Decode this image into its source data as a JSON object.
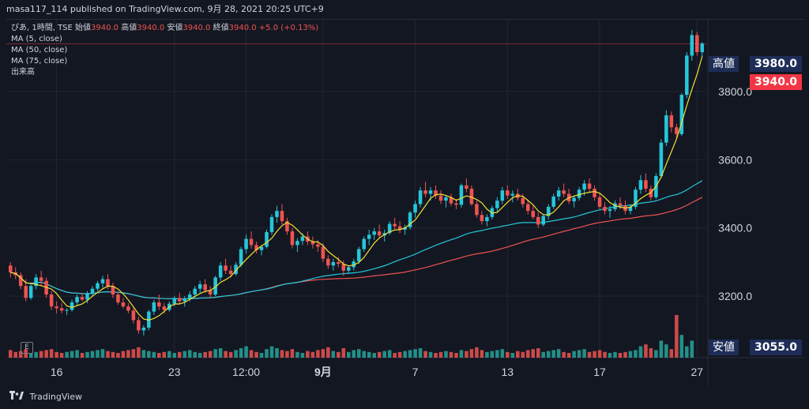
{
  "header": {
    "publisher_text": "masa117_114 published on TradingView.com, 9月 28, 2021 20:25 UTC+9"
  },
  "legend": {
    "symbol_text": "ぴあ, 1時間, TSE",
    "ohlc": [
      {
        "label": "始値",
        "value": "3940.0"
      },
      {
        "label": "高値",
        "value": "3940.0"
      },
      {
        "label": "安値",
        "value": "3940.0"
      },
      {
        "label": "終値",
        "value": "3940.0"
      }
    ],
    "change": "+5.0 (+0.13%)",
    "indicators": [
      "MA (5, close)",
      "MA (50, close)",
      "MA (75, close)",
      "出来高"
    ]
  },
  "price_tags": {
    "high_label": "高値",
    "high_value": "3980.0",
    "last_value": "3940.0",
    "low_label": "安値",
    "low_value": "3055.0"
  },
  "e_badge": "E",
  "footer": {
    "brand": "TradingView"
  },
  "colors": {
    "up": "#26a69a",
    "up_candle": "#26c6da",
    "down": "#ef5350",
    "ma5": "#f2e035",
    "ma50": "#26c6da",
    "ma75": "#ef5350",
    "high_tag_bg": "#1e2d57",
    "last_tag_bg": "#f23645"
  },
  "chart_data": {
    "type": "candlestick",
    "y_axis": {
      "min": 3020,
      "max": 4010,
      "ticks": [
        3200.0,
        3400.0,
        3600.0,
        3800.0
      ]
    },
    "x_ticks": [
      {
        "index": 9,
        "label": "16"
      },
      {
        "index": 32,
        "label": "23"
      },
      {
        "index": 46,
        "label": "12:00"
      },
      {
        "index": 61,
        "label": "9月"
      },
      {
        "index": 79,
        "label": "7"
      },
      {
        "index": 97,
        "label": "13"
      },
      {
        "index": 115,
        "label": "17"
      },
      {
        "index": 134,
        "label": "27"
      }
    ],
    "ohlc": [
      [
        3290,
        3300,
        3255,
        3270
      ],
      [
        3270,
        3285,
        3250,
        3262
      ],
      [
        3262,
        3270,
        3220,
        3230
      ],
      [
        3230,
        3250,
        3185,
        3195
      ],
      [
        3195,
        3240,
        3190,
        3230
      ],
      [
        3230,
        3265,
        3220,
        3255
      ],
      [
        3255,
        3275,
        3230,
        3245
      ],
      [
        3245,
        3255,
        3195,
        3205
      ],
      [
        3205,
        3215,
        3160,
        3170
      ],
      [
        3170,
        3185,
        3150,
        3165
      ],
      [
        3165,
        3180,
        3150,
        3158
      ],
      [
        3158,
        3165,
        3145,
        3160
      ],
      [
        3160,
        3190,
        3155,
        3182
      ],
      [
        3182,
        3205,
        3175,
        3198
      ],
      [
        3198,
        3210,
        3185,
        3190
      ],
      [
        3190,
        3215,
        3180,
        3208
      ],
      [
        3208,
        3230,
        3200,
        3222
      ],
      [
        3222,
        3245,
        3215,
        3238
      ],
      [
        3238,
        3260,
        3225,
        3250
      ],
      [
        3250,
        3265,
        3220,
        3230
      ],
      [
        3230,
        3240,
        3195,
        3205
      ],
      [
        3205,
        3215,
        3175,
        3182
      ],
      [
        3182,
        3195,
        3165,
        3170
      ],
      [
        3170,
        3180,
        3150,
        3158
      ],
      [
        3158,
        3165,
        3120,
        3130
      ],
      [
        3130,
        3140,
        3090,
        3100
      ],
      [
        3100,
        3115,
        3085,
        3108
      ],
      [
        3108,
        3160,
        3100,
        3155
      ],
      [
        3155,
        3190,
        3145,
        3182
      ],
      [
        3182,
        3205,
        3160,
        3170
      ],
      [
        3170,
        3180,
        3150,
        3160
      ],
      [
        3160,
        3185,
        3155,
        3178
      ],
      [
        3178,
        3200,
        3170,
        3195
      ],
      [
        3195,
        3210,
        3175,
        3185
      ],
      [
        3185,
        3200,
        3170,
        3192
      ],
      [
        3192,
        3215,
        3185,
        3205
      ],
      [
        3205,
        3230,
        3195,
        3222
      ],
      [
        3222,
        3245,
        3210,
        3235
      ],
      [
        3235,
        3250,
        3210,
        3218
      ],
      [
        3218,
        3230,
        3195,
        3205
      ],
      [
        3205,
        3260,
        3200,
        3255
      ],
      [
        3255,
        3300,
        3245,
        3290
      ],
      [
        3290,
        3310,
        3265,
        3275
      ],
      [
        3275,
        3290,
        3255,
        3265
      ],
      [
        3265,
        3300,
        3260,
        3292
      ],
      [
        3292,
        3345,
        3285,
        3338
      ],
      [
        3338,
        3380,
        3325,
        3368
      ],
      [
        3368,
        3390,
        3340,
        3350
      ],
      [
        3350,
        3360,
        3325,
        3335
      ],
      [
        3335,
        3350,
        3320,
        3345
      ],
      [
        3345,
        3395,
        3340,
        3388
      ],
      [
        3388,
        3440,
        3380,
        3432
      ],
      [
        3432,
        3465,
        3415,
        3450
      ],
      [
        3450,
        3470,
        3410,
        3420
      ],
      [
        3420,
        3430,
        3380,
        3390
      ],
      [
        3390,
        3400,
        3340,
        3350
      ],
      [
        3350,
        3370,
        3330,
        3362
      ],
      [
        3362,
        3385,
        3350,
        3375
      ],
      [
        3375,
        3390,
        3350,
        3360
      ],
      [
        3360,
        3375,
        3340,
        3352
      ],
      [
        3352,
        3365,
        3330,
        3345
      ],
      [
        3345,
        3355,
        3300,
        3310
      ],
      [
        3310,
        3320,
        3280,
        3290
      ],
      [
        3290,
        3310,
        3275,
        3300
      ],
      [
        3300,
        3315,
        3285,
        3295
      ],
      [
        3295,
        3305,
        3260,
        3275
      ],
      [
        3275,
        3290,
        3265,
        3285
      ],
      [
        3285,
        3310,
        3275,
        3302
      ],
      [
        3302,
        3345,
        3295,
        3338
      ],
      [
        3338,
        3375,
        3330,
        3368
      ],
      [
        3368,
        3395,
        3350,
        3380
      ],
      [
        3380,
        3400,
        3365,
        3390
      ],
      [
        3390,
        3410,
        3370,
        3378
      ],
      [
        3378,
        3395,
        3360,
        3385
      ],
      [
        3385,
        3420,
        3380,
        3412
      ],
      [
        3412,
        3430,
        3395,
        3405
      ],
      [
        3405,
        3420,
        3385,
        3395
      ],
      [
        3395,
        3410,
        3380,
        3402
      ],
      [
        3402,
        3450,
        3395,
        3445
      ],
      [
        3445,
        3480,
        3430,
        3470
      ],
      [
        3470,
        3520,
        3460,
        3510
      ],
      [
        3510,
        3535,
        3490,
        3500
      ],
      [
        3500,
        3520,
        3480,
        3510
      ],
      [
        3510,
        3525,
        3485,
        3495
      ],
      [
        3495,
        3510,
        3470,
        3480
      ],
      [
        3480,
        3495,
        3460,
        3490
      ],
      [
        3490,
        3500,
        3465,
        3472
      ],
      [
        3472,
        3485,
        3455,
        3468
      ],
      [
        3468,
        3530,
        3460,
        3525
      ],
      [
        3525,
        3545,
        3505,
        3515
      ],
      [
        3515,
        3525,
        3465,
        3470
      ],
      [
        3470,
        3480,
        3430,
        3438
      ],
      [
        3438,
        3450,
        3410,
        3420
      ],
      [
        3420,
        3440,
        3405,
        3432
      ],
      [
        3432,
        3465,
        3425,
        3458
      ],
      [
        3458,
        3490,
        3445,
        3480
      ],
      [
        3480,
        3520,
        3470,
        3510
      ],
      [
        3510,
        3525,
        3485,
        3495
      ],
      [
        3495,
        3510,
        3475,
        3500
      ],
      [
        3500,
        3515,
        3480,
        3488
      ],
      [
        3488,
        3500,
        3460,
        3470
      ],
      [
        3470,
        3480,
        3440,
        3450
      ],
      [
        3450,
        3465,
        3425,
        3432
      ],
      [
        3432,
        3445,
        3400,
        3410
      ],
      [
        3410,
        3440,
        3405,
        3435
      ],
      [
        3435,
        3470,
        3425,
        3462
      ],
      [
        3462,
        3500,
        3455,
        3492
      ],
      [
        3492,
        3520,
        3480,
        3510
      ],
      [
        3510,
        3530,
        3490,
        3500
      ],
      [
        3500,
        3515,
        3470,
        3478
      ],
      [
        3478,
        3495,
        3460,
        3488
      ],
      [
        3488,
        3520,
        3480,
        3512
      ],
      [
        3512,
        3540,
        3495,
        3530
      ],
      [
        3530,
        3545,
        3505,
        3515
      ],
      [
        3515,
        3525,
        3480,
        3490
      ],
      [
        3490,
        3500,
        3455,
        3462
      ],
      [
        3462,
        3475,
        3440,
        3450
      ],
      [
        3450,
        3465,
        3430,
        3455
      ],
      [
        3455,
        3480,
        3448,
        3472
      ],
      [
        3472,
        3490,
        3455,
        3465
      ],
      [
        3465,
        3480,
        3440,
        3450
      ],
      [
        3450,
        3470,
        3440,
        3462
      ],
      [
        3462,
        3520,
        3455,
        3512
      ],
      [
        3512,
        3555,
        3500,
        3540
      ],
      [
        3540,
        3560,
        3505,
        3515
      ],
      [
        3515,
        3525,
        3480,
        3490
      ],
      [
        3490,
        3560,
        3485,
        3552
      ],
      [
        3552,
        3660,
        3545,
        3650
      ],
      [
        3650,
        3745,
        3640,
        3730
      ],
      [
        3730,
        3742,
        3680,
        3695
      ],
      [
        3695,
        3705,
        3660,
        3675
      ],
      [
        3675,
        3795,
        3670,
        3790
      ],
      [
        3790,
        3915,
        3780,
        3905
      ],
      [
        3905,
        3980,
        3890,
        3965
      ],
      [
        3965,
        3975,
        3905,
        3915
      ],
      [
        3915,
        3945,
        3900,
        3940
      ]
    ],
    "volume_max": 100,
    "volume": [
      8,
      6,
      7,
      9,
      5,
      6,
      7,
      8,
      9,
      6,
      5,
      6,
      7,
      8,
      5,
      6,
      7,
      8,
      9,
      7,
      6,
      5,
      7,
      8,
      9,
      11,
      8,
      7,
      6,
      5,
      6,
      7,
      5,
      6,
      7,
      8,
      6,
      5,
      6,
      7,
      9,
      10,
      7,
      6,
      8,
      10,
      12,
      8,
      6,
      5,
      9,
      12,
      10,
      8,
      7,
      9,
      6,
      5,
      7,
      6,
      8,
      9,
      11,
      7,
      6,
      10,
      6,
      8,
      9,
      7,
      6,
      5,
      6,
      7,
      8,
      5,
      6,
      7,
      8,
      9,
      10,
      7,
      6,
      5,
      6,
      7,
      6,
      5,
      8,
      7,
      9,
      11,
      8,
      6,
      7,
      8,
      9,
      6,
      5,
      7,
      6,
      8,
      9,
      10,
      6,
      7,
      8,
      9,
      6,
      5,
      7,
      8,
      9,
      6,
      7,
      8,
      6,
      5,
      6,
      5,
      6,
      7,
      8,
      12,
      14,
      10,
      8,
      18,
      14,
      9,
      45,
      24,
      12,
      18
    ],
    "ma5_label": "MA (5, close)",
    "ma50_label": "MA (50, close)",
    "ma75_label": "MA (75, close)",
    "volume_label": "出来高"
  }
}
